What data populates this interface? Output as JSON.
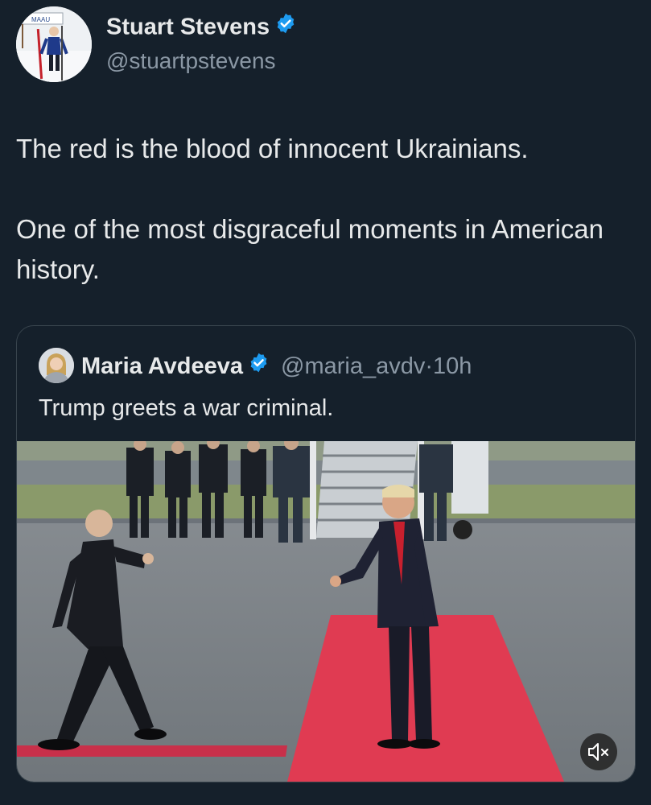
{
  "tweet": {
    "author_name": "Stuart Stevens",
    "author_handle": "@stuartpstevens",
    "verified": true,
    "avatar_icon": "profile-photo-skier",
    "avatar_sign_text": "MAAU",
    "text_paragraphs": [
      "The red is the blood of innocent Ukrainians.",
      "One of the most disgraceful moments in American history."
    ]
  },
  "quoted_tweet": {
    "author_name": "Maria Avdeeva",
    "author_handle": "@maria_avdv",
    "separator": "·",
    "time": "10h",
    "verified": true,
    "avatar_icon": "profile-photo-woman",
    "text": "Trump greets a war criminal.",
    "media": {
      "type": "video",
      "mute_icon": "speaker-muted-icon"
    }
  },
  "colors": {
    "background": "#15202b",
    "text_primary": "#e7e9ea",
    "text_secondary": "#8b98a5",
    "border": "#38444d",
    "verified_badge": "#1d9bf0",
    "red_carpet": "#e03b52"
  }
}
